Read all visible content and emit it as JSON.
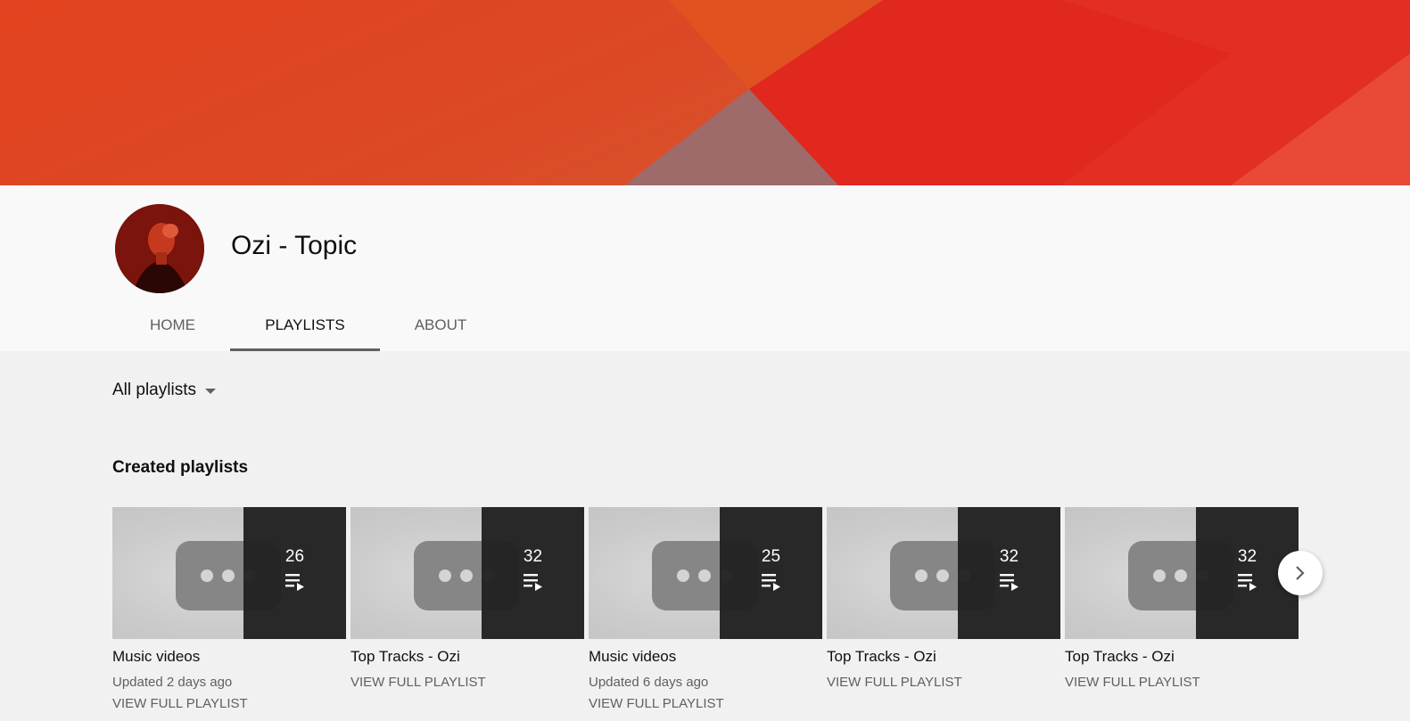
{
  "channel": {
    "name": "Ozi - Topic"
  },
  "tabs": [
    {
      "label": "HOME"
    },
    {
      "label": "PLAYLISTS"
    },
    {
      "label": "ABOUT"
    }
  ],
  "filter": {
    "label": "All playlists"
  },
  "section": {
    "title": "Created playlists"
  },
  "playlists": [
    {
      "title": "Music videos",
      "count": "26",
      "updated": "Updated 2 days ago",
      "view_label": "VIEW FULL PLAYLIST"
    },
    {
      "title": "Top Tracks - Ozi",
      "count": "32",
      "updated": "",
      "view_label": "VIEW FULL PLAYLIST"
    },
    {
      "title": "Music videos",
      "count": "25",
      "updated": "Updated 6 days ago",
      "view_label": "VIEW FULL PLAYLIST"
    },
    {
      "title": "Top Tracks - Ozi",
      "count": "32",
      "updated": "",
      "view_label": "VIEW FULL PLAYLIST"
    },
    {
      "title": "Top Tracks - Ozi",
      "count": "32",
      "updated": "",
      "view_label": "VIEW FULL PLAYLIST"
    }
  ],
  "icons": {
    "playlist": "playlist-play-icon",
    "next": "chevron-right-icon"
  },
  "colors": {
    "banner_primary": "#e2261e",
    "banner_secondary": "#e25322",
    "tab_active_underline": "#606060"
  }
}
